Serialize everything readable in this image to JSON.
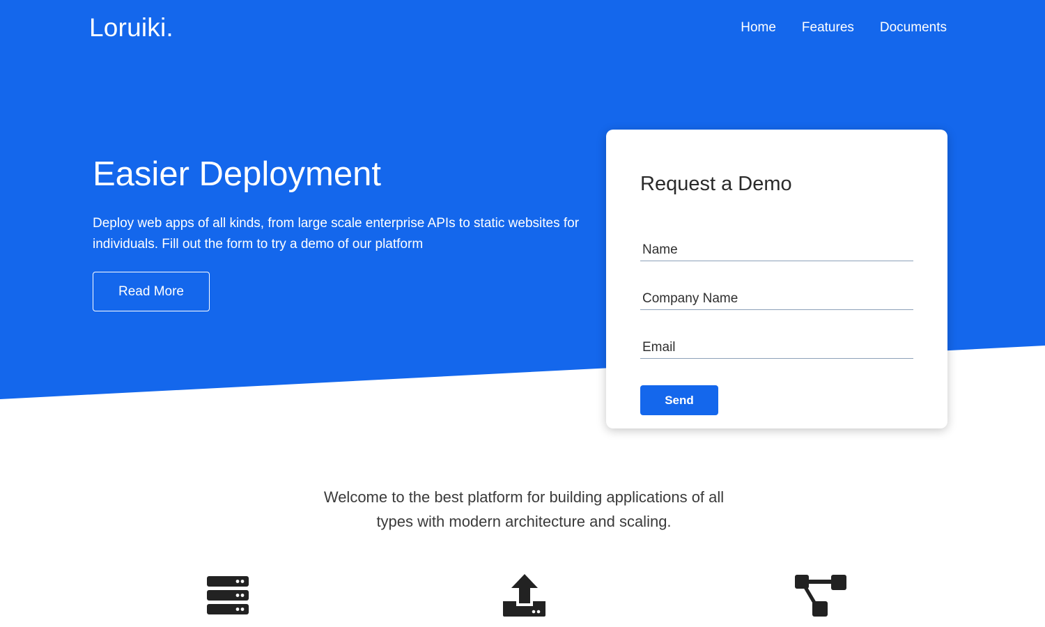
{
  "brand": {
    "logo": "Loruiki."
  },
  "nav": {
    "items": [
      {
        "label": "Home"
      },
      {
        "label": "Features"
      },
      {
        "label": "Documents"
      }
    ]
  },
  "hero": {
    "title": "Easier Deployment",
    "description": "Deploy web apps of all kinds, from large scale enterprise APIs to static websites for individuals. Fill out the form to try a demo of our platform",
    "read_more_label": "Read More"
  },
  "demo_form": {
    "title": "Request a Demo",
    "fields": [
      {
        "placeholder": "Name",
        "value": ""
      },
      {
        "placeholder": "Company Name",
        "value": ""
      },
      {
        "placeholder": "Email",
        "value": ""
      }
    ],
    "send_label": "Send"
  },
  "welcome": {
    "text": "Welcome to the best platform for building applications of all types with modern architecture and scaling."
  },
  "features": {
    "icons": [
      "server-icon",
      "upload-icon",
      "sitemap-icon"
    ]
  },
  "colors": {
    "primary": "#1467ec",
    "text_dark": "#2a2a2a",
    "icon": "#222222"
  }
}
